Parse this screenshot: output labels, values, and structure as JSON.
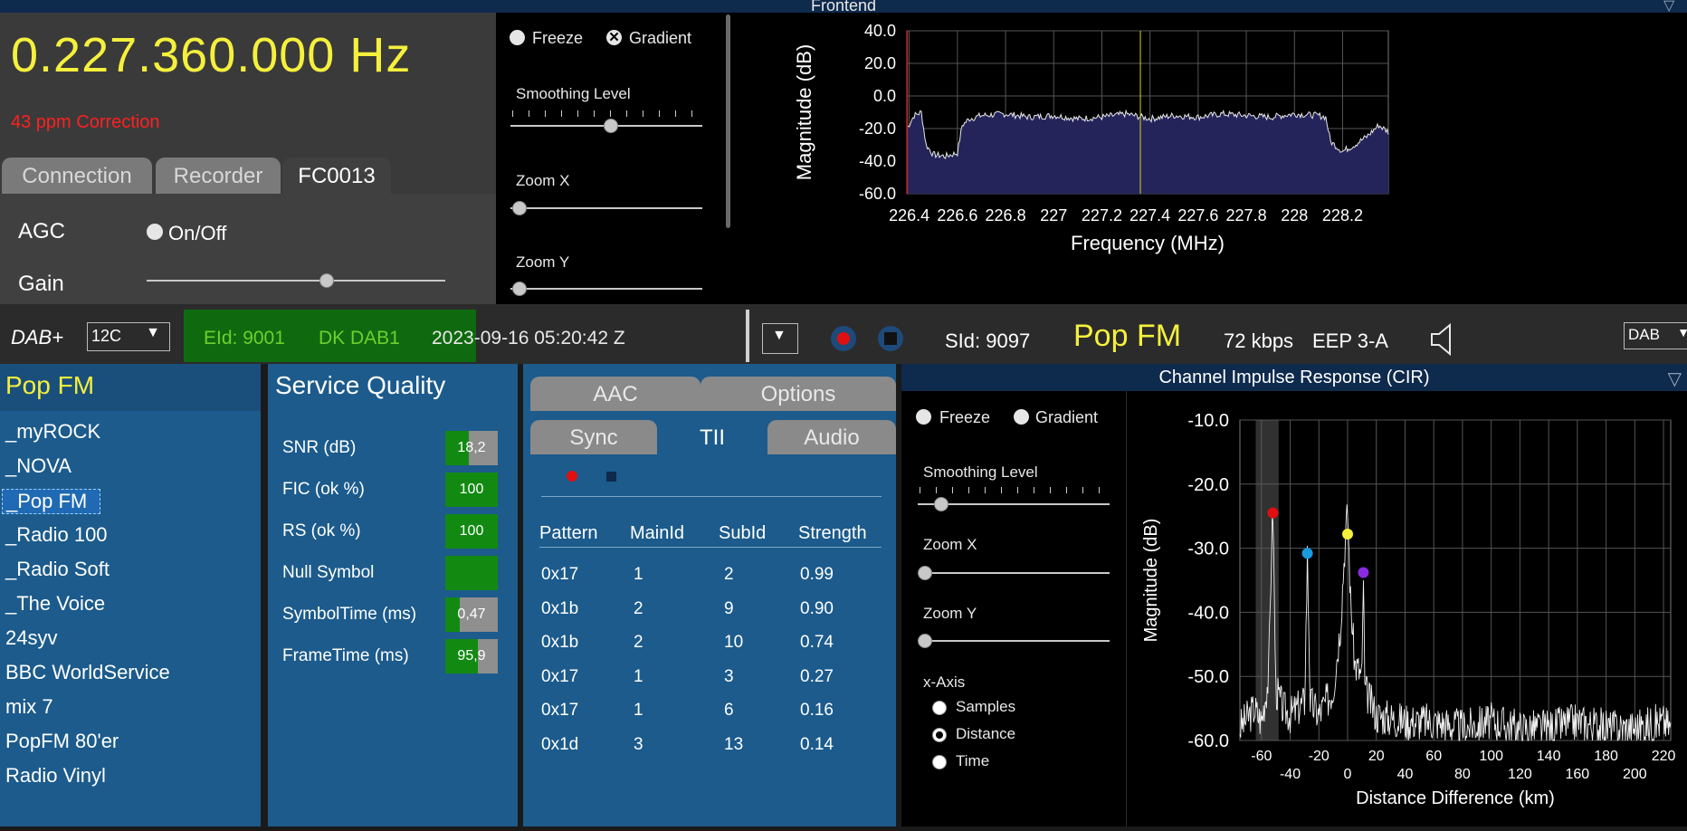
{
  "frontend": {
    "title": "Frontend",
    "frequency": "0.227.360.000",
    "frequency_unit": "Hz",
    "ppm_correction": "43 ppm Correction",
    "tabs": [
      {
        "label": "Connection"
      },
      {
        "label": "Recorder"
      },
      {
        "label": "FC0013",
        "active": true
      }
    ],
    "agc_label": "AGC",
    "agc_toggle_label": "On/Off",
    "gain_label": "Gain",
    "gain_level": 0.6
  },
  "spectrum_controls": {
    "freeze_label": "Freeze",
    "gradient_label": "Gradient",
    "smoothing_label": "Smoothing Level",
    "smoothing_level": 0.52,
    "zoom_x_label": "Zoom X",
    "zoom_x_level": 0.0,
    "zoom_y_label": "Zoom Y",
    "zoom_y_level": 0.0
  },
  "spectrum_chart": {
    "chart_data": {
      "type": "line",
      "xlabel": "Frequency (MHz)",
      "ylabel": "Magnitude (dB)",
      "xlim": [
        226.39,
        228.39
      ],
      "ylim": [
        -60,
        40
      ],
      "x_ticks": [
        226.4,
        226.6,
        226.8,
        227,
        227.2,
        227.4,
        227.6,
        227.8,
        228,
        228.2
      ],
      "x_tick_labels": [
        "226.4",
        "226.6",
        "226.8",
        "227",
        "227.2",
        "227.4",
        "227.6",
        "227.8",
        "228",
        "228.2"
      ],
      "y_ticks": [
        40,
        20,
        0,
        -20,
        -40,
        -60
      ],
      "y_tick_labels": [
        "40.0",
        "20.0",
        "0.0",
        "-20.0",
        "-40.0",
        "-60.0"
      ],
      "grid": true,
      "marker_x": 227.36,
      "series": [
        {
          "x": [
            226.39,
            226.42,
            226.45,
            226.47,
            226.5,
            226.55,
            226.6,
            226.62,
            226.65,
            226.7,
            226.8,
            226.9,
            227.0,
            227.1,
            227.2,
            227.3,
            227.4,
            227.5,
            227.6,
            227.7,
            227.8,
            227.9,
            228.0,
            228.1,
            228.13,
            228.15,
            228.2,
            228.25,
            228.3,
            228.35,
            228.39
          ],
          "y": [
            -20,
            -12,
            -10,
            -30,
            -36,
            -37,
            -35,
            -18,
            -14,
            -12,
            -11,
            -13,
            -12,
            -14,
            -13,
            -11,
            -14,
            -12,
            -13,
            -11,
            -12,
            -13,
            -11,
            -12,
            -13,
            -28,
            -34,
            -30,
            -25,
            -18,
            -22
          ]
        }
      ]
    }
  },
  "status_bar": {
    "mode": "DAB+",
    "channel": "12C",
    "eid": "EId: 9001",
    "ensemble": "DK DAB1",
    "datetime": "2023-09-16  05:20:42 Z",
    "sid": "SId: 9097",
    "service_name": "Pop FM",
    "bitrate": "72 kbps",
    "protection": "EEP 3-A",
    "band": "DAB",
    "colors": {
      "record": "#e01010",
      "accent_yellow": "#f5f03c"
    }
  },
  "services": {
    "title": "Pop FM",
    "items": [
      "_myROCK",
      "_NOVA",
      "_Pop FM",
      "_Radio 100",
      "_Radio Soft",
      "_The Voice",
      "24syv",
      "BBC WorldService",
      "mix 7",
      "PopFM 80'er",
      "Radio Vinyl"
    ],
    "selected": "_Pop FM"
  },
  "service_quality": {
    "title": "Service Quality",
    "rows": [
      {
        "label": "SNR (dB)",
        "value": "18,2",
        "level": 0.45
      },
      {
        "label": "FIC (ok %)",
        "value": "100",
        "level": 1.0
      },
      {
        "label": "RS (ok %)",
        "value": "100",
        "level": 1.0
      },
      {
        "label": "Null Symbol",
        "value": "",
        "level": 1.0
      },
      {
        "label": "SymbolTime (ms)",
        "value": "0,47",
        "level": 0.28
      },
      {
        "label": "FrameTime (ms)",
        "value": "95,9",
        "level": 0.62
      }
    ]
  },
  "tii": {
    "tabs_row1": [
      "AAC",
      "Options"
    ],
    "tabs_row2": [
      "Sync",
      "TII",
      "Audio"
    ],
    "active_tab": "TII",
    "columns": [
      "Pattern",
      "MainId",
      "SubId",
      "Strength"
    ],
    "rows": [
      [
        "0x17",
        "1",
        "2",
        "0.99"
      ],
      [
        "0x1b",
        "2",
        "9",
        "0.90"
      ],
      [
        "0x1b",
        "2",
        "10",
        "0.74"
      ],
      [
        "0x17",
        "1",
        "3",
        "0.27"
      ],
      [
        "0x17",
        "1",
        "6",
        "0.16"
      ],
      [
        "0x1d",
        "3",
        "13",
        "0.14"
      ]
    ]
  },
  "cir": {
    "title": "Channel Impulse Response (CIR)",
    "freeze_label": "Freeze",
    "gradient_label": "Gradient",
    "smoothing_label": "Smoothing Level",
    "smoothing_level": 0.12,
    "zoom_x_label": "Zoom X",
    "zoom_x_level": 0.0,
    "zoom_y_label": "Zoom Y",
    "zoom_y_level": 0.0,
    "xaxis_label": "x-Axis",
    "xaxis_options": [
      "Samples",
      "Distance",
      "Time"
    ],
    "xaxis_selected": "Distance",
    "chart_data": {
      "type": "line",
      "xlabel": "Distance Difference (km)",
      "ylabel": "Magnitude (dB)",
      "xlim": [
        -75,
        225
      ],
      "ylim": [
        -60,
        -10
      ],
      "x_tick_labels_top": [
        "-60",
        "-20",
        "20",
        "60",
        "100",
        "140",
        "180",
        "220"
      ],
      "x_tick_labels_bottom": [
        "-40",
        "0",
        "40",
        "80",
        "120",
        "160",
        "200"
      ],
      "y_ticks": [
        -10,
        -20,
        -30,
        -40,
        -50,
        -60
      ],
      "y_tick_labels": [
        "-10.0",
        "-20.0",
        "-30.0",
        "-40.0",
        "-50.0",
        "-60.0"
      ],
      "grid": true,
      "markers": [
        {
          "x": -52,
          "y": -24.5,
          "color": "#e01010"
        },
        {
          "x": -28,
          "y": -30.8,
          "color": "#1a9ae0"
        },
        {
          "x": 0,
          "y": -27.8,
          "color": "#f5f03c"
        },
        {
          "x": 11,
          "y": -33.8,
          "color": "#8a2be2"
        }
      ],
      "series": [
        {
          "x": [
            -75,
            -65,
            -60,
            -55,
            -53,
            -52,
            -50,
            -45,
            -40,
            -30,
            -28,
            -26,
            -20,
            -10,
            -5,
            -2,
            0,
            2,
            5,
            10,
            11,
            12,
            20,
            40,
            60,
            80,
            100,
            120,
            140,
            160,
            180,
            200,
            220,
            225
          ],
          "y": [
            -58,
            -55,
            -57,
            -50,
            -30,
            -24,
            -52,
            -55,
            -56,
            -54,
            -31,
            -54,
            -56,
            -52,
            -42,
            -30,
            -24,
            -38,
            -48,
            -50,
            -34,
            -52,
            -56,
            -57,
            -57,
            -58,
            -57,
            -58,
            -58,
            -57,
            -58,
            -58,
            -57,
            -58
          ]
        }
      ]
    }
  }
}
